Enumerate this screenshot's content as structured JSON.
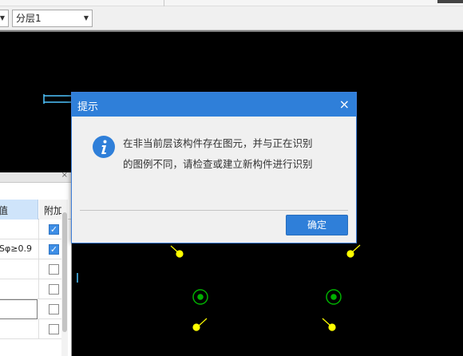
{
  "toolbar": {
    "combo_a_value": "",
    "combo_b_value": "分层1"
  },
  "panel": {
    "close_glyph": "×",
    "header_value_col": "值",
    "header_extra_col": "附加",
    "rows": [
      {
        "value": "",
        "checked": true
      },
      {
        "value": "Sφ≥0.9",
        "checked": true
      },
      {
        "value": "",
        "checked": false
      },
      {
        "value": "",
        "checked": false
      },
      {
        "value": "",
        "checked": false
      },
      {
        "value": "",
        "checked": false
      }
    ]
  },
  "dialog": {
    "title": "提示",
    "close_glyph": "×",
    "message_line1": "在非当前层该构件存在图元，并与正在识别",
    "message_line2": "的图例不同，请检查或建立新构件进行识别",
    "ok_label": "确定",
    "icon": "info-icon"
  },
  "colors": {
    "accent": "#2f7fd9",
    "cad_cyan": "#4fc6ff",
    "cad_yellow": "#ffff00",
    "cad_green": "#00b000"
  }
}
